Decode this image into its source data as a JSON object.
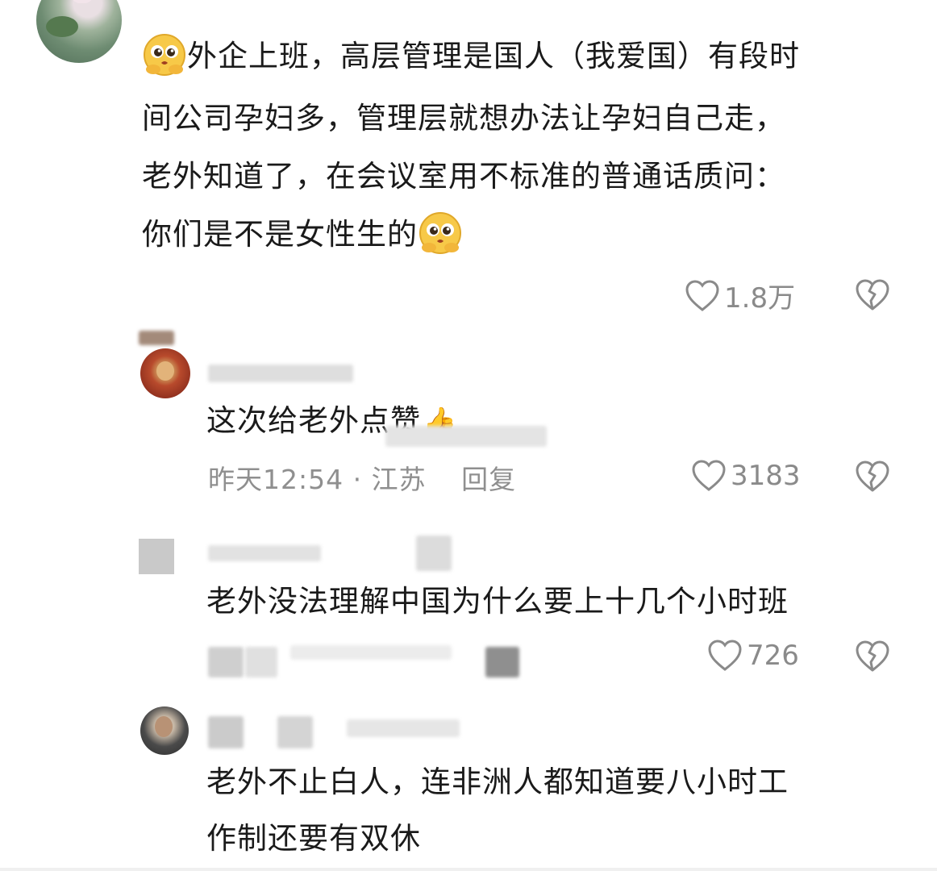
{
  "comments": [
    {
      "lines": [
        "外企上班，高层管理是国人（我爱国）有段时",
        "间公司孕妇多，管理层就想办法让孕妇自己走，",
        "老外知道了，在会议室用不标准的普通话质问：",
        "你们是不是女性生的"
      ],
      "likes": "1.8万"
    },
    {
      "text": "这次给老外点赞",
      "emoji": "👍",
      "meta_time": "昨天12:54",
      "meta_location": "江苏",
      "meta_reply": "回复",
      "likes": "3183"
    },
    {
      "text": "老外没法理解中国为什么要上十几个小时班",
      "likes": "726"
    },
    {
      "lines": [
        "老外不止白人，连非洲人都知道要八小时工",
        "作制还要有双休"
      ]
    }
  ],
  "icons": {
    "like": "heart-outline-icon",
    "dislike": "broken-heart-icon",
    "emoji_face": "pleading-face-emoji-icon",
    "emoji_thumb": "thumbs-up-emoji-icon"
  },
  "colors": {
    "text": "#1a1a1a",
    "meta": "#8f8f8f",
    "icon": "#8a8a8a"
  }
}
